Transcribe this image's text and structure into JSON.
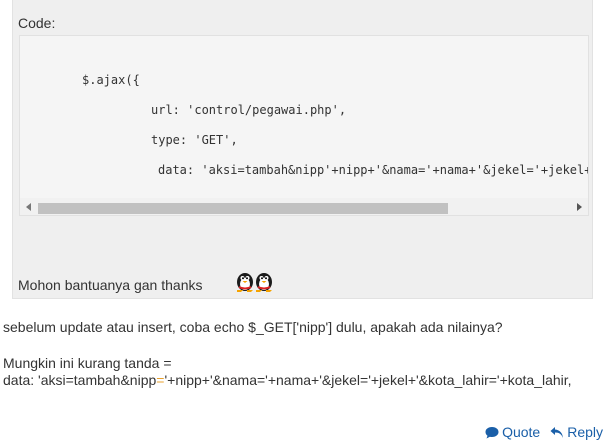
{
  "post": {
    "code_label": "Code:",
    "code_lines": [
      "$.ajax({",
      "url: 'control/pegawai.php',",
      "type: 'GET',",
      "data: 'aksi=tambah&nipp'+nipp+'&nama='+nama+'&jekel='+jekel+'&kota_lahir='+kota_lahir,"
    ],
    "thanks": "Mohon bantuanya gan thanks",
    "emoticon": "two-penguins-emoticon"
  },
  "reply": {
    "line1": "sebelum update atau insert, coba echo $_GET['nipp'] dulu, apakah ada nilainya?",
    "line2": "Mungkin ini kurang tanda =",
    "line3_before": "data: 'aksi=tambah&nipp",
    "line3_highlight": "=",
    "line3_after": "'+nipp+'&nama='+nama+'&jekel='+jekel+'&kota_lahir='+kota_lahir,"
  },
  "actions": {
    "quote_label": "Quote",
    "reply_label": "Reply",
    "quote_icon": "speech-bubble-icon",
    "reply_icon": "reply-arrow-icon"
  },
  "colors": {
    "accent": "#1a5fa8",
    "highlight": "#e8a02c",
    "post_bg": "#efefef",
    "code_bg": "#f5f5f5"
  }
}
